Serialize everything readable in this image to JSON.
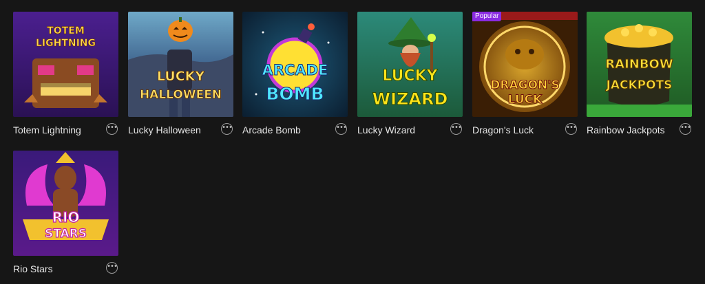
{
  "games": [
    {
      "title": "Totem Lightning",
      "logo_lines": [
        "TOTEM",
        "LIGHTNING"
      ],
      "more_icon": "ellipsis-icon"
    },
    {
      "title": "Lucky Halloween",
      "logo_lines": [
        "LUCKY",
        "HALLOWEEN"
      ],
      "more_icon": "ellipsis-icon"
    },
    {
      "title": "Arcade Bomb",
      "logo_lines": [
        "ARCADE",
        "BOMB"
      ],
      "more_icon": "ellipsis-icon"
    },
    {
      "title": "Lucky Wizard",
      "logo_lines": [
        "LUCKY",
        "WIZARD"
      ],
      "more_icon": "ellipsis-icon"
    },
    {
      "title": "Dragon's Luck",
      "badge": "Popular",
      "logo_lines": [
        "DRAGON'S",
        "LUCK"
      ],
      "more_icon": "ellipsis-icon"
    },
    {
      "title": "Rainbow Jackpots",
      "logo_lines": [
        "RAINBOW",
        "JACKPOTS"
      ],
      "more_icon": "ellipsis-icon"
    },
    {
      "title": "Rio Stars",
      "logo_lines": [
        "RIO",
        "STARS"
      ],
      "more_icon": "ellipsis-icon"
    }
  ],
  "more_symbol": "•••",
  "colors": {
    "background": "#161616",
    "title_text": "#e6e6e6",
    "badge": "#8a2be2"
  }
}
